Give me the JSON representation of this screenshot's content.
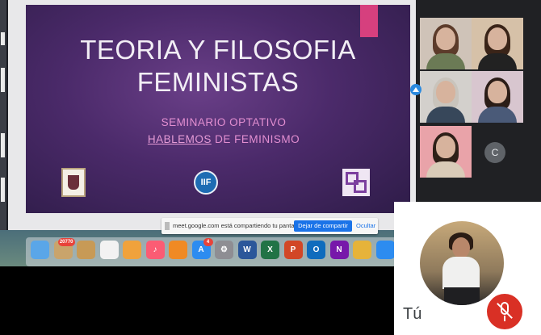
{
  "slide": {
    "title_line1": "TEORIA Y FILOSOFIA",
    "title_line2": "FEMINISTAS",
    "subtitle_line1": "SEMINARIO  OPTATIVO",
    "subtitle_line2_underlined": "HABLEMOS",
    "subtitle_line2_rest": " DE FEMINISMO",
    "logo_center_text": "IIF"
  },
  "share_notice": {
    "message": "meet.google.com está compartiendo tu pantalla.",
    "stop_label": "Dejar de compartir",
    "hide_label": "Ocultar"
  },
  "dock": {
    "icons": [
      {
        "name": "finder-icon",
        "color": "#5aa6e8",
        "glyph": ""
      },
      {
        "name": "contacts-icon",
        "color": "#c9a46b",
        "glyph": "",
        "badge": "20770"
      },
      {
        "name": "notes-icon",
        "color": "#c79a56",
        "glyph": ""
      },
      {
        "name": "reminders-icon",
        "color": "#f2f2f2",
        "glyph": ""
      },
      {
        "name": "photos-icon",
        "color": "#f0a23c",
        "glyph": ""
      },
      {
        "name": "music-icon",
        "color": "#fb5c74",
        "glyph": "♪"
      },
      {
        "name": "books-icon",
        "color": "#f08a24",
        "glyph": ""
      },
      {
        "name": "app-store-icon",
        "color": "#2d8cf0",
        "glyph": "A",
        "badge": "4"
      },
      {
        "name": "settings-icon",
        "color": "#8e8e93",
        "glyph": "⚙"
      },
      {
        "name": "word-icon",
        "color": "#2b579a",
        "glyph": "W"
      },
      {
        "name": "excel-icon",
        "color": "#217346",
        "glyph": "X"
      },
      {
        "name": "powerpoint-icon",
        "color": "#d24726",
        "glyph": "P"
      },
      {
        "name": "outlook-icon",
        "color": "#0f6cbd",
        "glyph": "O"
      },
      {
        "name": "onenote-icon",
        "color": "#7719aa",
        "glyph": "N"
      },
      {
        "name": "chrome-icon",
        "color": "#e6b33a",
        "glyph": ""
      },
      {
        "name": "meet-icon",
        "color": "#2d8cf0",
        "glyph": ""
      }
    ]
  },
  "participants": [
    {
      "name": "participant-1",
      "bg": "#cfc3b8",
      "hair": "#5c3b2a",
      "body": "#6b7a55"
    },
    {
      "name": "participant-2",
      "bg": "#d6c1a8",
      "hair": "#3a2418",
      "body": "#222222"
    },
    {
      "name": "participant-3",
      "bg": "#d3d0cc",
      "hair": "#c9c4bc",
      "body": "#37475a"
    },
    {
      "name": "participant-4",
      "bg": "#d8c6cf",
      "hair": "#2b1d17",
      "body": "#4a5a78"
    },
    {
      "name": "participant-5",
      "bg": "#e9a3a9",
      "hair": "#2e2018",
      "body": "#d9cbb8"
    }
  ],
  "avatar_initial": "C",
  "self_view": {
    "name": "Tú",
    "mic_state": "muted"
  }
}
